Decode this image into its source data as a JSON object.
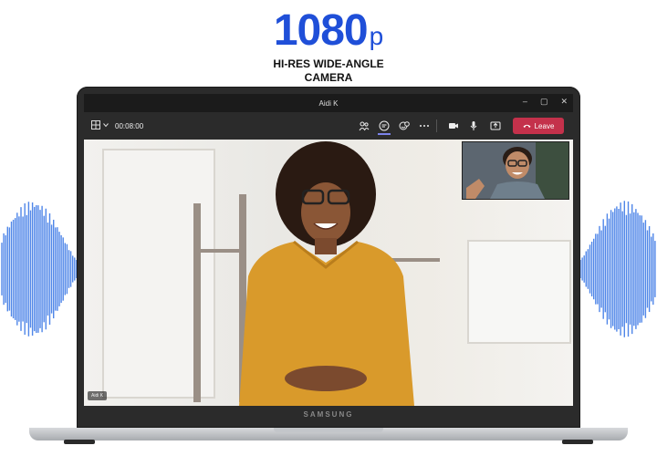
{
  "headline": {
    "number": "1080",
    "suffix": "p",
    "line1": "HI-RES WIDE-ANGLE",
    "line2": "CAMERA"
  },
  "window": {
    "title": "Aidi K",
    "minimize": "–",
    "maximize": "▢",
    "close": "✕"
  },
  "toolbar": {
    "timer": "00:08:00",
    "leave_label": "Leave"
  },
  "video": {
    "name_tag": "Aidi K"
  },
  "laptop": {
    "brand": "SAMSUNG"
  },
  "colors": {
    "accent": "#1f4fd8",
    "leave": "#c4314b",
    "active_tab": "#7b83eb"
  },
  "icons": [
    "layout-grid-icon",
    "people-icon",
    "chat-icon",
    "reactions-icon",
    "more-icon",
    "camera-icon",
    "mic-icon",
    "share-icon",
    "phone-icon"
  ]
}
